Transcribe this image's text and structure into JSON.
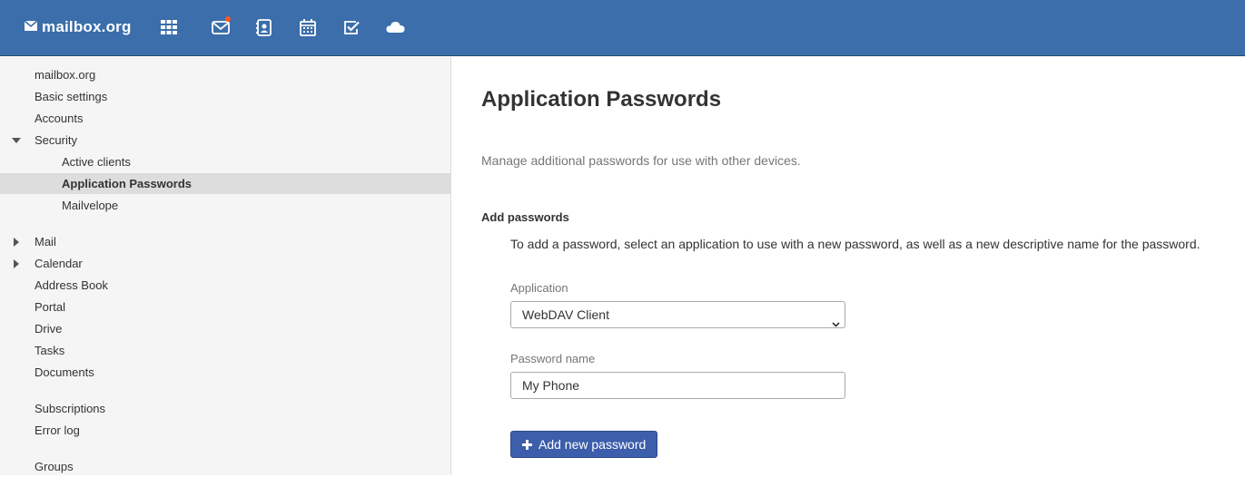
{
  "topbar": {
    "logo_text": "mailbox.org",
    "icons": [
      "envelope-icon",
      "apps-grid-icon",
      "mail-icon",
      "contacts-icon",
      "calendar-icon",
      "tasks-icon",
      "cloud-icon"
    ],
    "mail_has_notification": true,
    "accent_color": "#3b6eab",
    "notification_color": "#ff5a1f"
  },
  "sidebar": {
    "items": [
      {
        "label": "mailbox.org"
      },
      {
        "label": "Basic settings"
      },
      {
        "label": "Accounts"
      },
      {
        "label": "Security",
        "expanded": true
      },
      {
        "label": "Active clients"
      },
      {
        "label": "Application Passwords",
        "selected": true
      },
      {
        "label": "Mailvelope"
      },
      {
        "label": "Mail",
        "expanded": false
      },
      {
        "label": "Calendar",
        "expanded": false
      },
      {
        "label": "Address Book"
      },
      {
        "label": "Portal"
      },
      {
        "label": "Drive"
      },
      {
        "label": "Tasks"
      },
      {
        "label": "Documents"
      },
      {
        "label": "Subscriptions"
      },
      {
        "label": "Error log"
      },
      {
        "label": "Groups"
      }
    ]
  },
  "main": {
    "title": "Application Passwords",
    "description": "Manage additional passwords for use with other devices.",
    "section_title": "Add passwords",
    "section_help": "To add a password, select an application to use with a new password, as well as a new descriptive name for the password.",
    "application_label": "Application",
    "application_value": "WebDAV Client",
    "password_name_label": "Password name",
    "password_name_value": "My Phone",
    "add_button_label": "Add new password",
    "button_color": "#3c5eab"
  }
}
